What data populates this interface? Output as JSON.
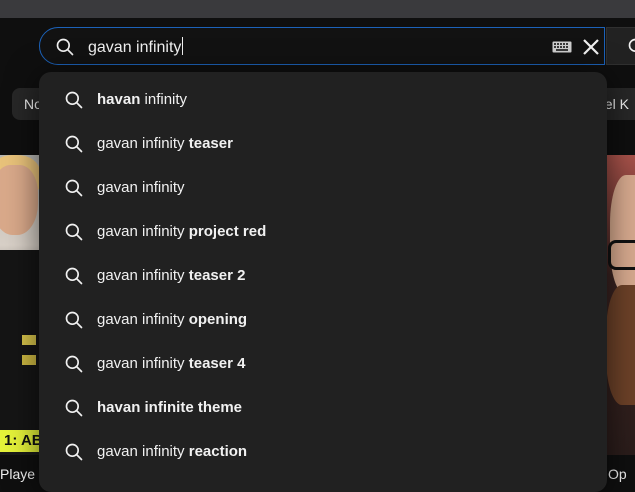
{
  "search": {
    "query": "gavan infinity"
  },
  "chips": {
    "left_label": "No",
    "right_label": "ael K"
  },
  "suggestions": [
    {
      "prefix": "",
      "bold_start": "havan",
      "rest": " infinity",
      "bold_end": ""
    },
    {
      "prefix": "gavan infinity ",
      "bold_start": "",
      "rest": "",
      "bold_end": "teaser"
    },
    {
      "prefix": "gavan infinity",
      "bold_start": "",
      "rest": "",
      "bold_end": ""
    },
    {
      "prefix": "gavan infinity ",
      "bold_start": "",
      "rest": "",
      "bold_end": "project red"
    },
    {
      "prefix": "gavan infinity ",
      "bold_start": "",
      "rest": "",
      "bold_end": "teaser 2"
    },
    {
      "prefix": "gavan infinity ",
      "bold_start": "",
      "rest": "",
      "bold_end": "opening"
    },
    {
      "prefix": "gavan infinity ",
      "bold_start": "",
      "rest": "",
      "bold_end": "teaser 4"
    },
    {
      "prefix": "",
      "bold_start": "havan infinite theme",
      "rest": "",
      "bold_end": ""
    },
    {
      "prefix": "gavan infinity ",
      "bold_start": "",
      "rest": "",
      "bold_end": "reaction"
    }
  ],
  "thumbnails": {
    "left_badge": "1: AB",
    "left_title": "Playe",
    "right_title": "Op"
  },
  "colors": {
    "accent": "#1c62b9",
    "dropdown_bg": "#212121",
    "badge": "#e5f23a"
  },
  "icons": {
    "search": "search-icon",
    "keyboard": "keyboard-icon",
    "clear": "close-icon"
  }
}
